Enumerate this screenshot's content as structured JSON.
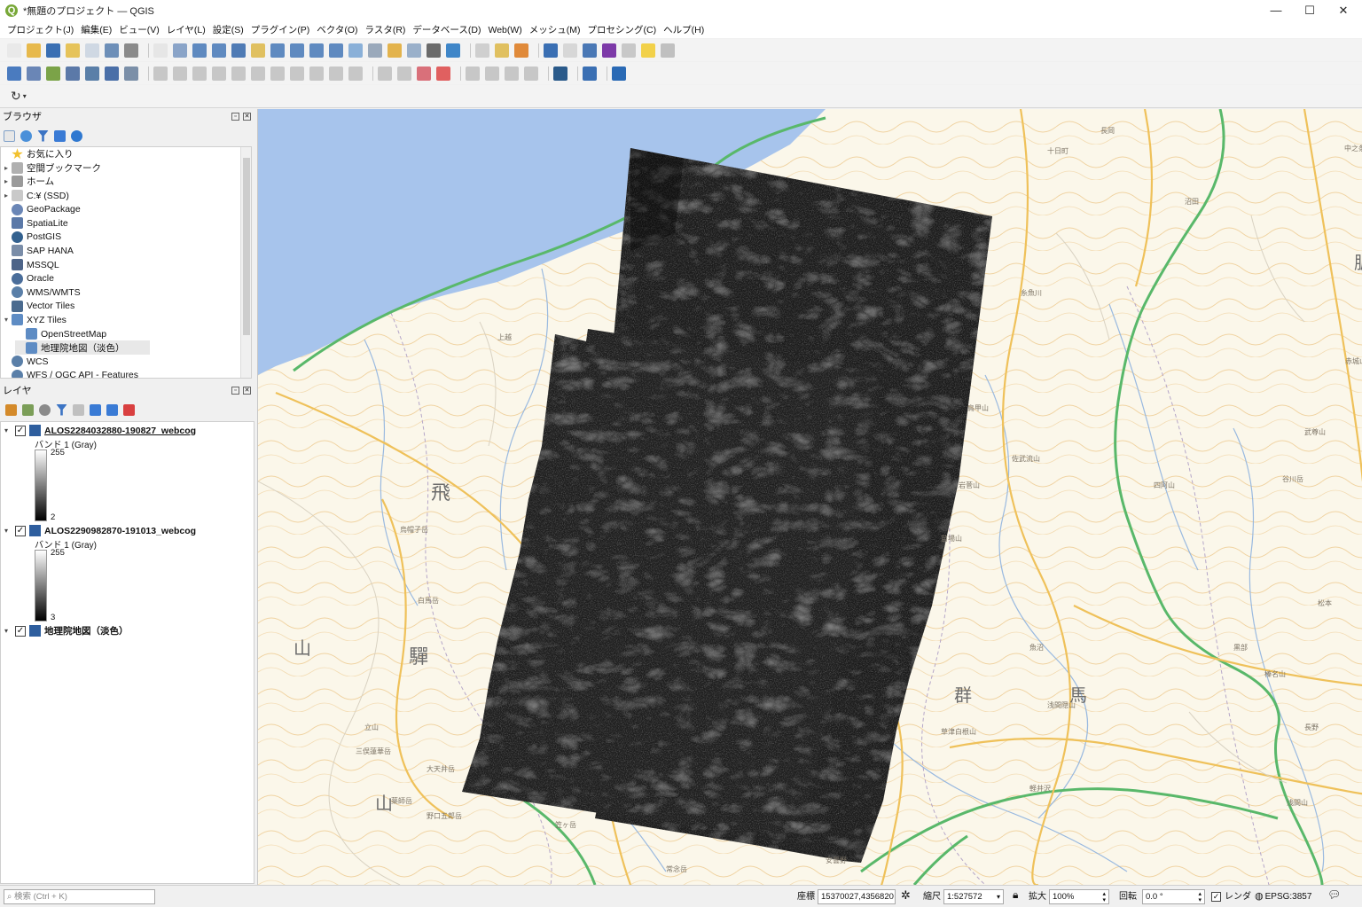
{
  "window": {
    "title": "*無題のプロジェクト — QGIS",
    "logo": "Q",
    "minimize": "—",
    "maximize": "☐",
    "close": "✕"
  },
  "menu": [
    "プロジェクト(J)",
    "編集(E)",
    "ビュー(V)",
    "レイヤ(L)",
    "設定(S)",
    "プラグイン(P)",
    "ベクタ(O)",
    "ラスタ(R)",
    "データベース(D)",
    "Web(W)",
    "メッシュ(M)",
    "プロセシング(C)",
    "ヘルプ(H)"
  ],
  "browser": {
    "title": "ブラウザ",
    "items": [
      {
        "label": "お気に入り",
        "expand": "",
        "icon": "star-icon",
        "color": "#f2c12e",
        "indent": 0
      },
      {
        "label": "空間ブックマーク",
        "expand": "▸",
        "icon": "bookmark-icon",
        "color": "#b0b0b0",
        "indent": 0
      },
      {
        "label": "ホーム",
        "expand": "▸",
        "icon": "home-folder-icon",
        "color": "#9a9a9a",
        "indent": 0
      },
      {
        "label": "C:¥ (SSD)",
        "expand": "▸",
        "icon": "drive-icon",
        "color": "#c9c9c9",
        "indent": 0
      },
      {
        "label": "GeoPackage",
        "expand": "",
        "icon": "geopackage-icon",
        "color": "#6a86b6",
        "indent": 0
      },
      {
        "label": "SpatiaLite",
        "expand": "",
        "icon": "spatialite-icon",
        "color": "#5b79a8",
        "indent": 0
      },
      {
        "label": "PostGIS",
        "expand": "",
        "icon": "postgis-icon",
        "color": "#33618f",
        "indent": 0
      },
      {
        "label": "SAP HANA",
        "expand": "",
        "icon": "saphana-icon",
        "color": "#7a8da8",
        "indent": 0
      },
      {
        "label": "MSSQL",
        "expand": "",
        "icon": "mssql-icon",
        "color": "#4d6488",
        "indent": 0
      },
      {
        "label": "Oracle",
        "expand": "",
        "icon": "oracle-icon",
        "color": "#4a6d9a",
        "indent": 0
      },
      {
        "label": "WMS/WMTS",
        "expand": "",
        "icon": "wms-globe-icon",
        "color": "#5a7fa8",
        "indent": 0
      },
      {
        "label": "Vector Tiles",
        "expand": "",
        "icon": "vector-tiles-icon",
        "color": "#4b6b8f",
        "indent": 0
      },
      {
        "label": "XYZ Tiles",
        "expand": "▾",
        "icon": "xyz-tiles-icon",
        "color": "#5e8cc4",
        "indent": 0
      },
      {
        "label": "OpenStreetMap",
        "expand": "",
        "icon": "xyz-tile-icon",
        "color": "#5e8cc4",
        "indent": 1
      },
      {
        "label": "地理院地図（淡色）",
        "expand": "",
        "icon": "xyz-tile-icon",
        "color": "#5e8cc4",
        "indent": 1,
        "selected": true
      },
      {
        "label": "WCS",
        "expand": "",
        "icon": "wcs-globe-icon",
        "color": "#5a7fa8",
        "indent": 0
      },
      {
        "label": "WFS / OGC API - Features",
        "expand": "",
        "icon": "wfs-globe-icon",
        "color": "#5a7fa8",
        "indent": 0
      }
    ]
  },
  "layers": {
    "title": "レイヤ",
    "items": [
      {
        "name": "ALOS2284032880-190827_webcog",
        "band": "バンド 1 (Gray)",
        "max": "255",
        "min": "2"
      },
      {
        "name": "ALOS2290982870-191013_webcog",
        "band": "バンド 1 (Gray)",
        "max": "255",
        "min": "3"
      },
      {
        "name": "地理院地図（淡色）"
      }
    ]
  },
  "map": {
    "labels": [
      {
        "text": "飛",
        "big": true
      },
      {
        "text": "山",
        "big": true
      },
      {
        "text": "驒",
        "big": true
      },
      {
        "text": "山",
        "big": true
      },
      {
        "text": "群",
        "big": true
      },
      {
        "text": "馬",
        "big": true
      },
      {
        "text": "脈",
        "big": true
      },
      {
        "text": "三俣蓮華岳"
      },
      {
        "text": "大天井岳"
      },
      {
        "text": "岩菅山"
      },
      {
        "text": "苗場山"
      },
      {
        "text": "谷川岳"
      },
      {
        "text": "武尊山"
      },
      {
        "text": "赤城山"
      },
      {
        "text": "浅間隠山"
      },
      {
        "text": "軽井沢"
      },
      {
        "text": "草津白根山"
      },
      {
        "text": "四阿山"
      },
      {
        "text": "鳥甲山"
      },
      {
        "text": "佐武流山"
      },
      {
        "text": "烏帽子岳"
      },
      {
        "text": "白馬岳"
      },
      {
        "text": "立山"
      },
      {
        "text": "薬師岳"
      },
      {
        "text": "野口五郎岳"
      },
      {
        "text": "笠ヶ岳"
      },
      {
        "text": "常念岳"
      },
      {
        "text": "安曇野"
      },
      {
        "text": "松本"
      },
      {
        "text": "長野"
      },
      {
        "text": "中之条"
      },
      {
        "text": "沼田"
      },
      {
        "text": "長岡"
      },
      {
        "text": "十日町"
      },
      {
        "text": "上越"
      },
      {
        "text": "糸魚川"
      },
      {
        "text": "黒部"
      },
      {
        "text": "魚沼"
      },
      {
        "text": "榛名山"
      },
      {
        "text": "浅間山"
      }
    ]
  },
  "search": {
    "placeholder": "検索 (Ctrl + K)"
  },
  "status": {
    "coord_label": "座標",
    "coord_value": "15370027,4356820",
    "scale_label": "縮尺",
    "scale_value": "1:527572",
    "magnify_label": "拡大",
    "magnify_value": "100%",
    "rotation_label": "回転",
    "rotation_value": "0.0 °",
    "render_label": "レンダ",
    "crs": "EPSG:3857"
  }
}
